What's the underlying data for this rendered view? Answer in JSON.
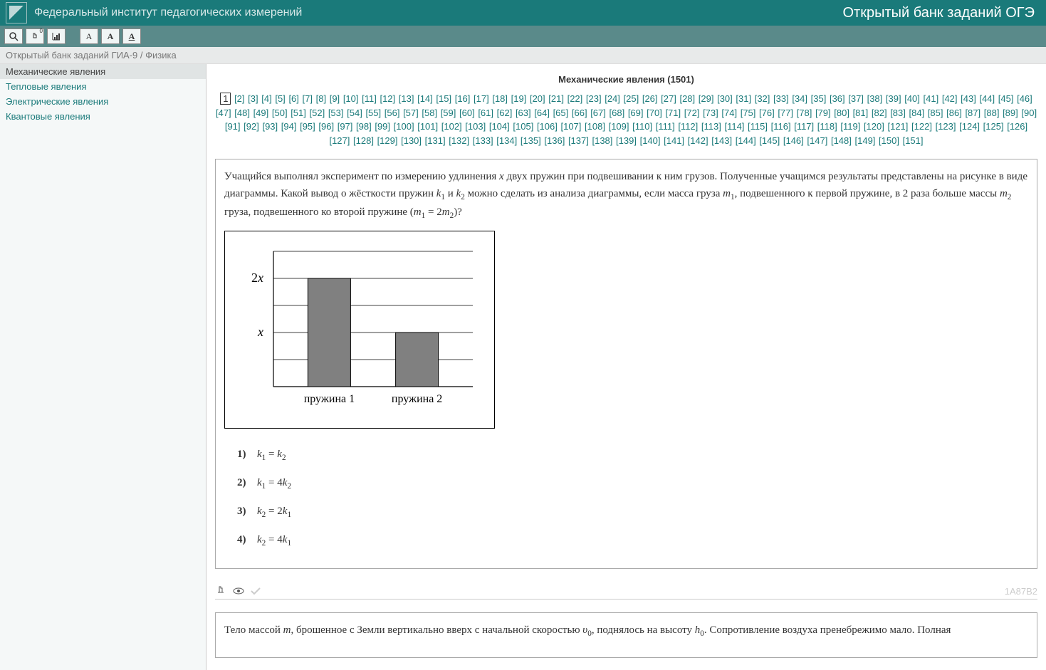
{
  "header": {
    "institute": "Федеральный институт педагогических измерений",
    "bank_title": "Открытый банк заданий ОГЭ"
  },
  "breadcrumb": "Открытый банк заданий ГИА-9 / Физика",
  "sidebar": {
    "items": [
      {
        "label": "Механические явления",
        "active": true
      },
      {
        "label": "Тепловые явления",
        "active": false
      },
      {
        "label": "Электрические явления",
        "active": false
      },
      {
        "label": "Квантовые явления",
        "active": false
      }
    ]
  },
  "page": {
    "title": "Механические явления (1501)",
    "current_page": 1,
    "total_pages": 151
  },
  "task1": {
    "text_before_x": "Учащийся выполнял эксперимент по измерению удлинения ",
    "text_after_x": " двух пружин при подвешивании к ним грузов. Полученные учащимся результаты представлены на рисунке в виде диаграммы. Какой вывод о жёсткости пружин ",
    "text_mid1": " и ",
    "text_mid2": " можно сделать из анализа диаграммы, если масса груза ",
    "text_mid3": ", подвешенного к первой пружине, в 2 раза больше массы ",
    "text_mid4": " груза, подвешенного ко второй пружине (",
    "text_end": ")?",
    "answers": [
      {
        "n": "1)",
        "html": "k₁ = k₂"
      },
      {
        "n": "2)",
        "html": "k₁ = 4k₂"
      },
      {
        "n": "3)",
        "html": "k₂ = 2k₁"
      },
      {
        "n": "4)",
        "html": "k₂ = 4k₁"
      }
    ],
    "id": "1A87B2"
  },
  "task2": {
    "text": "Тело массой m, брошенное с Земли вертикально вверх с начальной скоростью υ₀, поднялось на высоту h₀. Сопротивление воздуха пренебрежимо мало. Полная"
  },
  "chart_data": {
    "type": "bar",
    "categories": [
      "пружина 1",
      "пружина 2"
    ],
    "values": [
      2,
      1
    ],
    "ylabel_ticks": [
      "x",
      "2x"
    ],
    "ylim": [
      0,
      2.5
    ],
    "gridlines": [
      0.5,
      1,
      1.5,
      2,
      2.5
    ]
  }
}
